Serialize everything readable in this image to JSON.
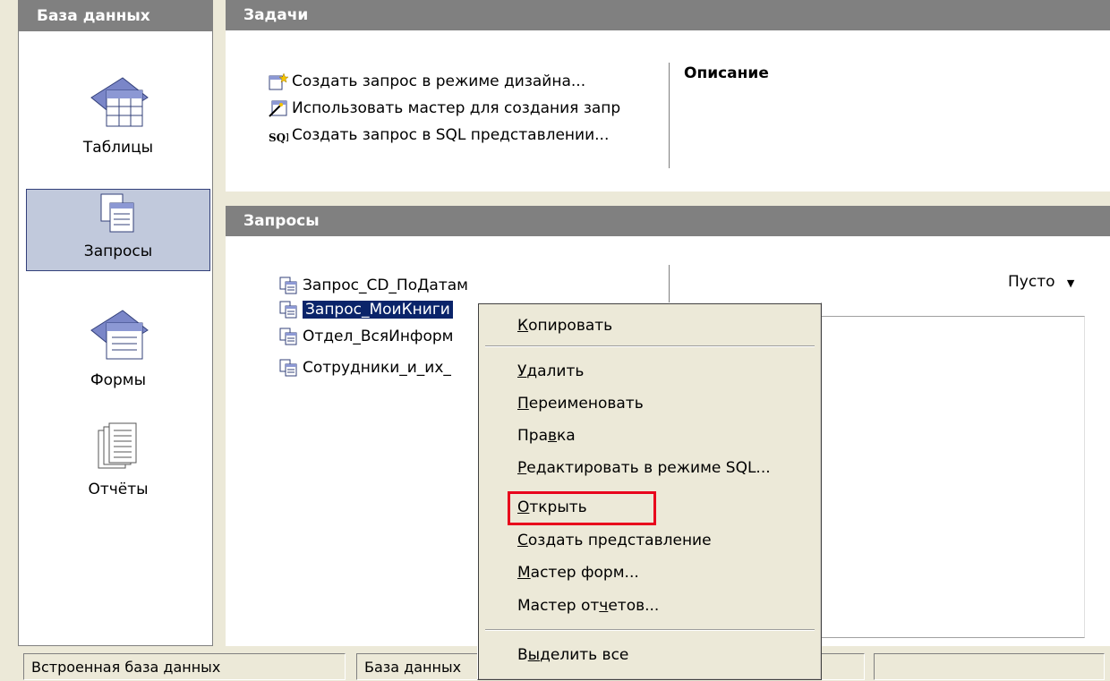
{
  "sidebar": {
    "header": "База данных",
    "items": [
      {
        "label": "Таблицы",
        "icon": "tables-icon",
        "selected": false
      },
      {
        "label": "Запросы",
        "icon": "queries-icon",
        "selected": true
      },
      {
        "label": "Формы",
        "icon": "forms-icon",
        "selected": false
      },
      {
        "label": "Отчёты",
        "icon": "reports-icon",
        "selected": false
      }
    ]
  },
  "tasks": {
    "header": "Задачи",
    "items": [
      {
        "label": "Создать запрос в режиме дизайна...",
        "icon": "design-query-icon"
      },
      {
        "label": "Использовать мастер для создания запр",
        "icon": "wizard-icon"
      },
      {
        "label": "Создать запрос в SQL представлении...",
        "icon": "sql-icon"
      }
    ],
    "description_label": "Описание"
  },
  "queries": {
    "header": "Запросы",
    "items": [
      {
        "label": "Запрос_CD_ПоДатам",
        "selected": false
      },
      {
        "label": "Запрос_МоиКниги",
        "selected": true
      },
      {
        "label": "Отдел_ВсяИнформ",
        "selected": false
      },
      {
        "label": "Сотрудники_и_их_",
        "selected": false
      }
    ],
    "preview_dropdown": "Пусто"
  },
  "context_menu": {
    "items": [
      {
        "label": "Копировать",
        "highlighted": false
      },
      {
        "label": "Удалить",
        "highlighted": false
      },
      {
        "label": "Переименовать",
        "highlighted": false
      },
      {
        "label": "Правка",
        "highlighted": false
      },
      {
        "label": "Редактировать в режиме SQL...",
        "highlighted": false
      },
      {
        "label": "Открыть",
        "highlighted": true
      },
      {
        "label": "Создать представление",
        "highlighted": false
      },
      {
        "label": "Мастер форм...",
        "highlighted": false
      },
      {
        "label": "Мастер отчетов...",
        "highlighted": false
      },
      {
        "label": "Выделить все",
        "highlighted": false
      }
    ]
  },
  "statusbar": {
    "embedded": "Встроенная база данных",
    "db": "База данных"
  },
  "colors": {
    "header_bg": "#808080",
    "selection": "#0a246a",
    "highlight_box": "#e8001c",
    "nav_selected": "#c1c9dc"
  }
}
